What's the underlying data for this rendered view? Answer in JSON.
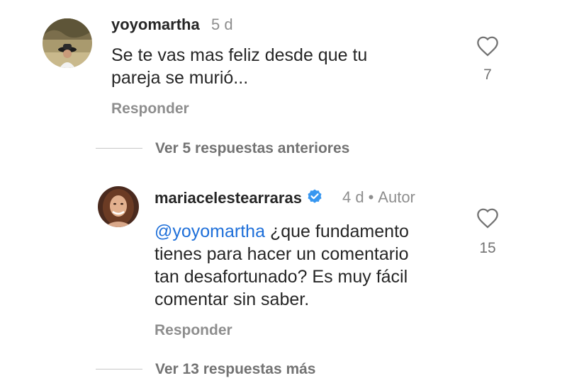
{
  "comment1": {
    "username": "yoyomartha",
    "time": "5 d",
    "lines": [
      "Se te vas mas feliz desde que tu",
      "pareja se murió..."
    ],
    "reply_label": "Responder",
    "likes": "7"
  },
  "view_previous": "Ver 5 respuestas anteriores",
  "comment2": {
    "username": "mariacelestearraras",
    "time": "4 d",
    "separator": "•",
    "author_badge": "Autor",
    "mention": "@yoyomartha",
    "line1_rest": " ¿que fundamento",
    "lines": [
      "tienes para hacer un comentario",
      "tan desafortunado? Es muy fácil",
      "comentar sin saber."
    ],
    "reply_label": "Responder",
    "likes": "15"
  },
  "view_more": "Ver 13 respuestas más",
  "colors": {
    "verified": "#3897f0",
    "mention": "#1e6fd9",
    "muted": "#8e8e8e"
  }
}
